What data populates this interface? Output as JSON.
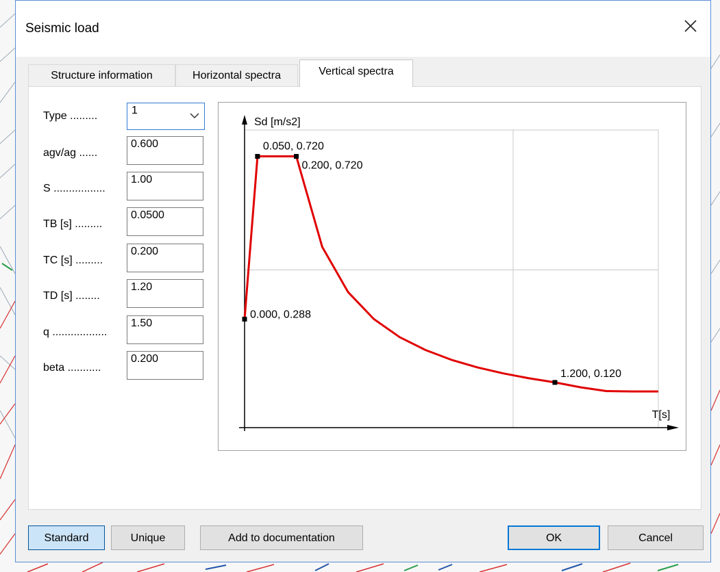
{
  "dialog": {
    "title": "Seismic load"
  },
  "tabs": [
    {
      "label": "Structure information"
    },
    {
      "label": "Horizontal spectra"
    },
    {
      "label": "Vertical spectra"
    }
  ],
  "params": {
    "type": {
      "label": "Type .........",
      "value": "1"
    },
    "agv_ag": {
      "label": "agv/ag ......",
      "value": "0.600"
    },
    "s": {
      "label": "S .................",
      "value": "1.00"
    },
    "tb": {
      "label": "TB [s] .........",
      "value": "0.0500"
    },
    "tc": {
      "label": "TC [s] .........",
      "value": "0.200"
    },
    "td": {
      "label": "TD [s] ........",
      "value": "1.20"
    },
    "q": {
      "label": "q ..................",
      "value": "1.50"
    },
    "beta": {
      "label": "beta ...........",
      "value": "0.200"
    }
  },
  "buttons": {
    "standard": "Standard",
    "unique": "Unique",
    "add_doc": "Add to documentation",
    "ok": "OK",
    "cancel": "Cancel"
  },
  "chart_data": {
    "type": "line",
    "ylabel": "Sd [m/s2]",
    "xlabel": "T[s]",
    "xlim": [
      0,
      1.6
    ],
    "ylim": [
      0,
      0.79
    ],
    "grid": true,
    "series_color": "#e00000",
    "series": [
      {
        "x": [
          0.0,
          0.05,
          0.2,
          0.3,
          0.4,
          0.5,
          0.6,
          0.7,
          0.8,
          0.9,
          1.0,
          1.1,
          1.2,
          1.3,
          1.4,
          1.5,
          1.6
        ],
        "y": [
          0.288,
          0.72,
          0.72,
          0.48,
          0.36,
          0.288,
          0.24,
          0.206,
          0.18,
          0.16,
          0.144,
          0.131,
          0.12,
          0.107,
          0.097,
          0.096,
          0.096
        ]
      }
    ],
    "point_labels": [
      {
        "x": 0.0,
        "y": 0.288,
        "text": "0.000, 0.288"
      },
      {
        "x": 0.05,
        "y": 0.72,
        "text": "0.050, 0.720"
      },
      {
        "x": 0.2,
        "y": 0.72,
        "text": "0.200, 0.720"
      },
      {
        "x": 1.2,
        "y": 0.12,
        "text": "1.200, 0.120"
      }
    ]
  }
}
